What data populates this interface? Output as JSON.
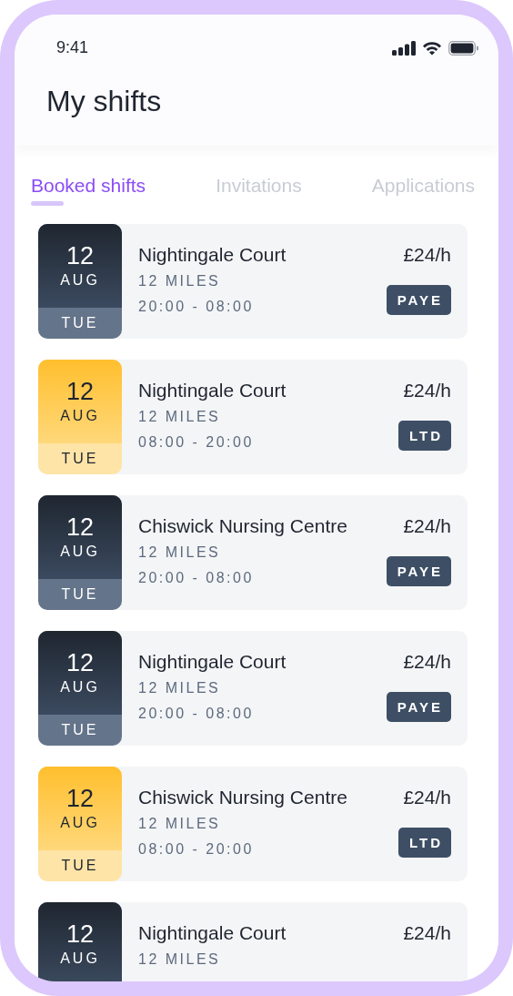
{
  "status_bar": {
    "time": "9:41"
  },
  "title": "My shifts",
  "tabs": [
    {
      "label": "Booked shifts",
      "selected": true
    },
    {
      "label": "Invitations",
      "selected": false
    },
    {
      "label": "Applications",
      "selected": false
    }
  ],
  "shifts": [
    {
      "kind": "night",
      "day": "12",
      "month": "AUG",
      "weekday": "TUE",
      "name": "Nightingale Court",
      "rate": "£24/h",
      "distance": "12 MILES",
      "time": "20:00 - 08:00",
      "contract": "PAYE"
    },
    {
      "kind": "day",
      "day": "12",
      "month": "AUG",
      "weekday": "TUE",
      "name": "Nightingale Court",
      "rate": "£24/h",
      "distance": "12 MILES",
      "time": "08:00 - 20:00",
      "contract": "LTD"
    },
    {
      "kind": "night",
      "day": "12",
      "month": "AUG",
      "weekday": "TUE",
      "name": "Chiswick Nursing Centre",
      "rate": "£24/h",
      "distance": "12 MILES",
      "time": "20:00 - 08:00",
      "contract": "PAYE"
    },
    {
      "kind": "night",
      "day": "12",
      "month": "AUG",
      "weekday": "TUE",
      "name": "Nightingale Court",
      "rate": "£24/h",
      "distance": "12 MILES",
      "time": "20:00 - 08:00",
      "contract": "PAYE"
    },
    {
      "kind": "day",
      "day": "12",
      "month": "AUG",
      "weekday": "TUE",
      "name": "Chiswick Nursing Centre",
      "rate": "£24/h",
      "distance": "12 MILES",
      "time": "08:00 - 20:00",
      "contract": "LTD"
    },
    {
      "kind": "night",
      "day": "12",
      "month": "AUG",
      "name": "Nightingale Court",
      "rate": "£24/h",
      "distance": "12 MILES"
    }
  ]
}
